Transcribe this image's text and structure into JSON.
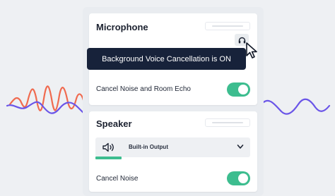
{
  "colors": {
    "accent_green": "#3dbd8f",
    "tooltip_bg": "#17223a",
    "wave_red": "#f06a4f",
    "wave_purple": "#6a55e8"
  },
  "microphone": {
    "title": "Microphone",
    "icon": "headphones-icon",
    "tooltip": "Background Voice Cancellation is ON",
    "noise_label": "Cancel Noise and Room Echo",
    "noise_on": true
  },
  "speaker": {
    "title": "Speaker",
    "icon": "speaker-icon",
    "output_value": "Built-in Output",
    "noise_label": "Cancel Noise",
    "noise_on": true
  }
}
